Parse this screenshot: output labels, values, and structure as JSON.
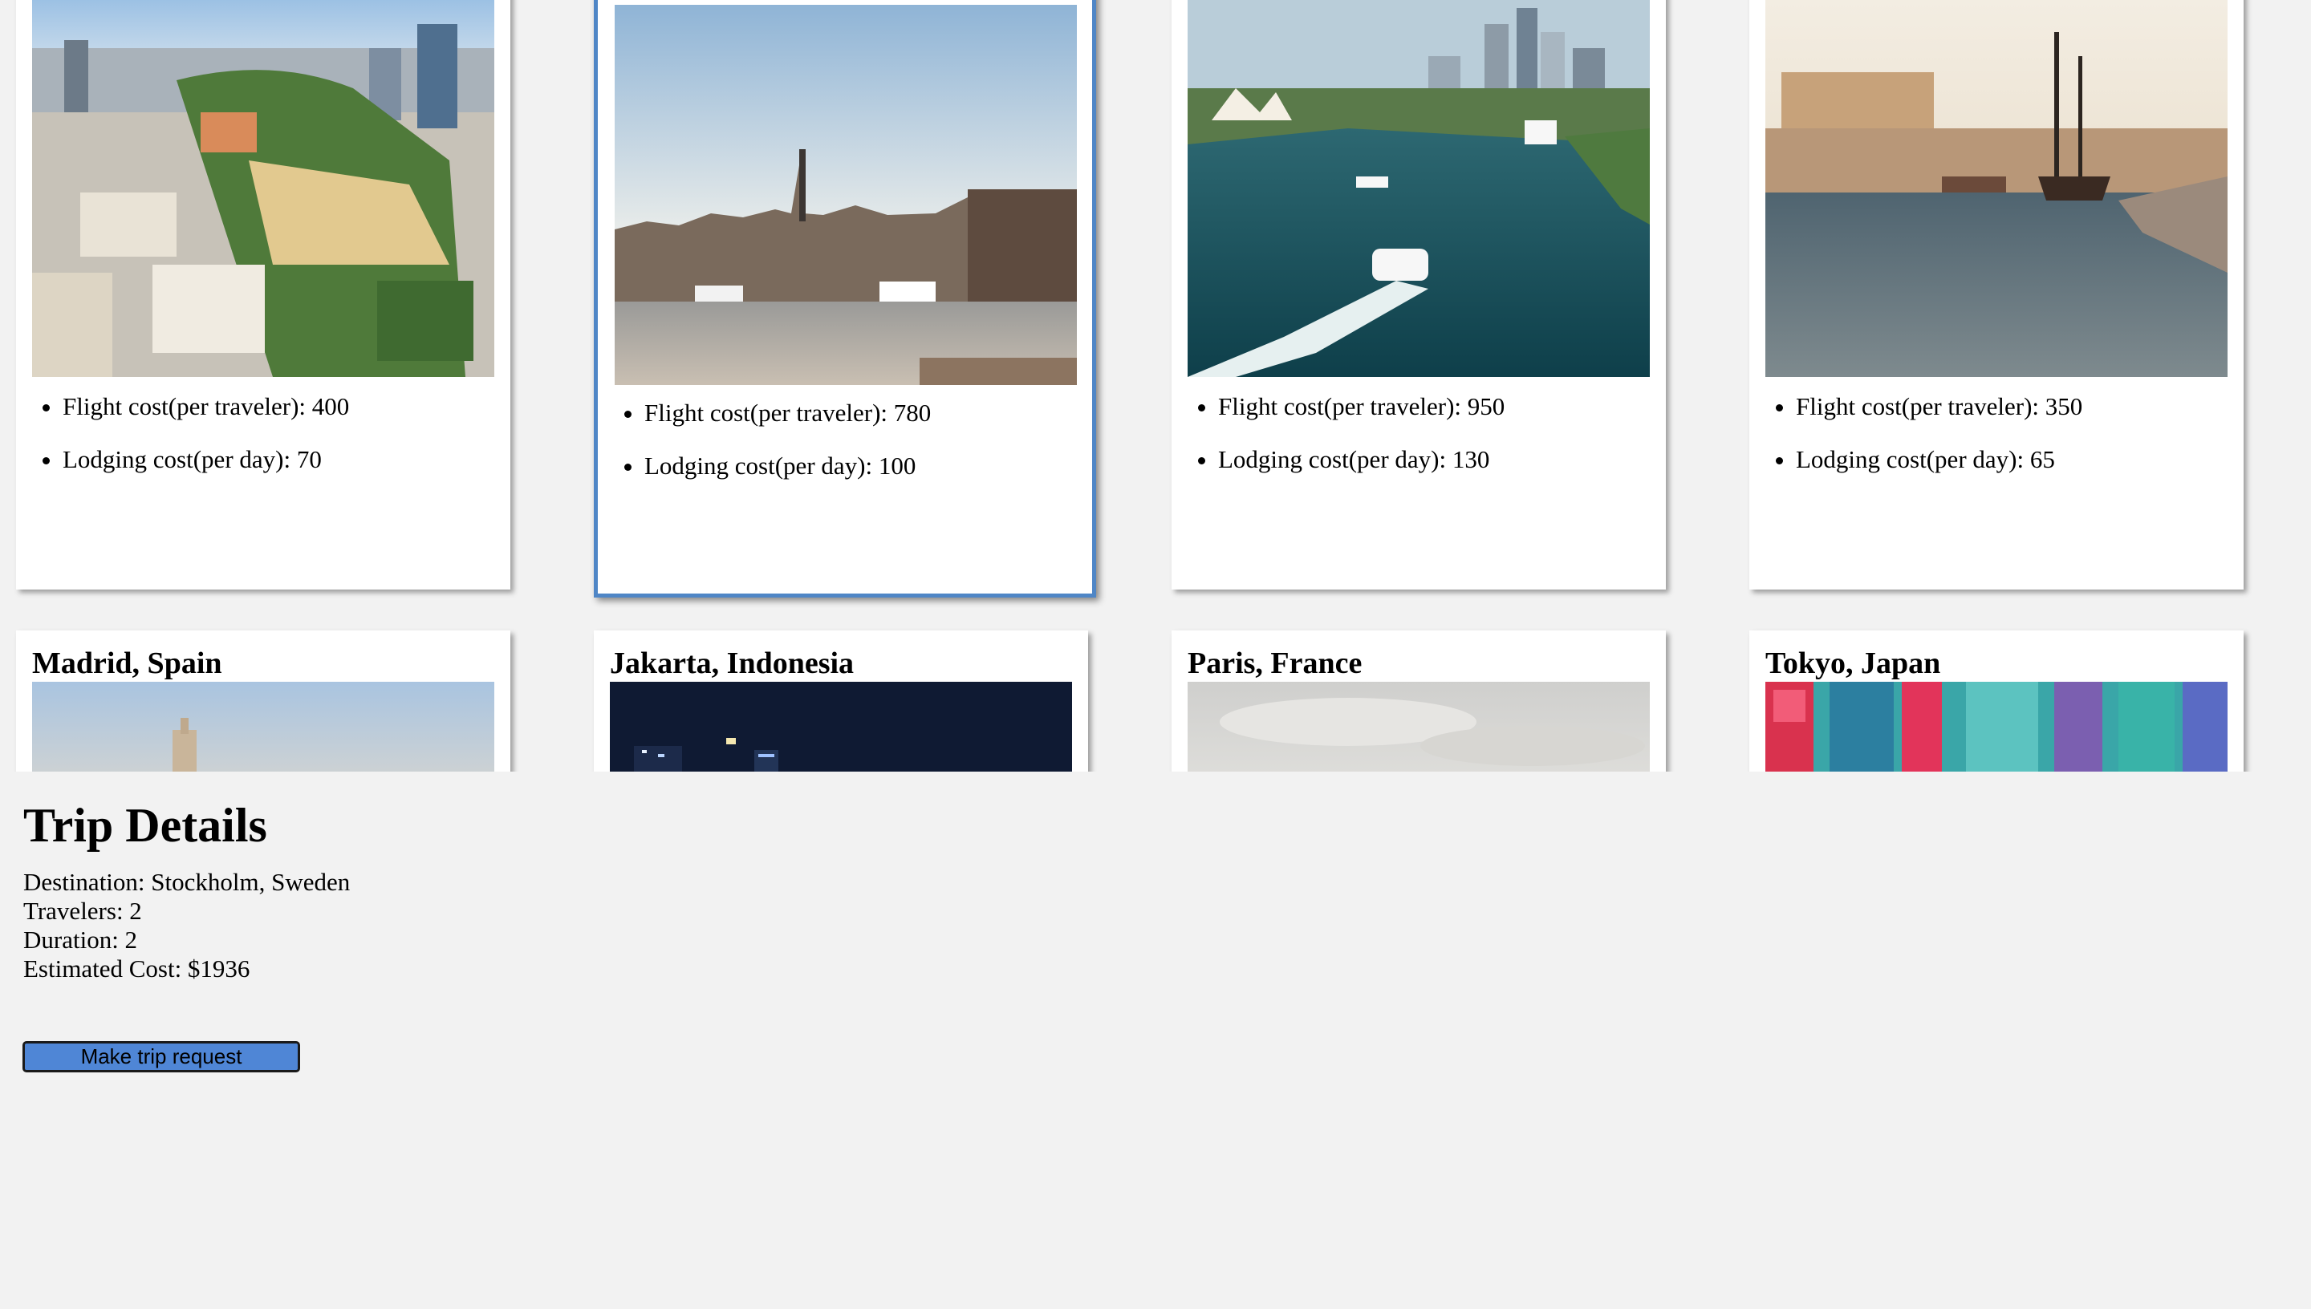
{
  "top_cards": [
    {
      "flight_cost": "Flight cost(per traveler): 400",
      "lodging_cost": "Lodging cost(per day): 70",
      "image": "city-aerial-photo"
    },
    {
      "flight_cost": "Flight cost(per traveler): 780",
      "lodging_cost": "Lodging cost(per day): 100",
      "image": "harbor-skyline-photo",
      "selected": true
    },
    {
      "flight_cost": "Flight cost(per traveler): 950",
      "lodging_cost": "Lodging cost(per day): 130",
      "image": "harbor-opera-house-photo"
    },
    {
      "flight_cost": "Flight cost(per traveler): 350",
      "lodging_cost": "Lodging cost(per day): 65",
      "image": "port-sailing-ship-photo"
    }
  ],
  "bottom_cards": [
    {
      "title": "Madrid, Spain",
      "image": "madrid-photo"
    },
    {
      "title": "Jakarta, Indonesia",
      "image": "jakarta-night-photo"
    },
    {
      "title": "Paris, France",
      "image": "paris-cloudy-photo"
    },
    {
      "title": "Tokyo, Japan",
      "image": "tokyo-street-photo"
    }
  ],
  "trip_details": {
    "heading": "Trip Details",
    "destination": "Destination: Stockholm, Sweden",
    "travelers": "Travelers: 2",
    "duration": "Duration: 2",
    "estimated_cost": "Estimated Cost: $1936"
  },
  "request_button": {
    "label": "Make trip request"
  },
  "colors": {
    "background": "#f2f2f2",
    "selected_border": "#4f86c6",
    "button": "#4f86d6"
  }
}
